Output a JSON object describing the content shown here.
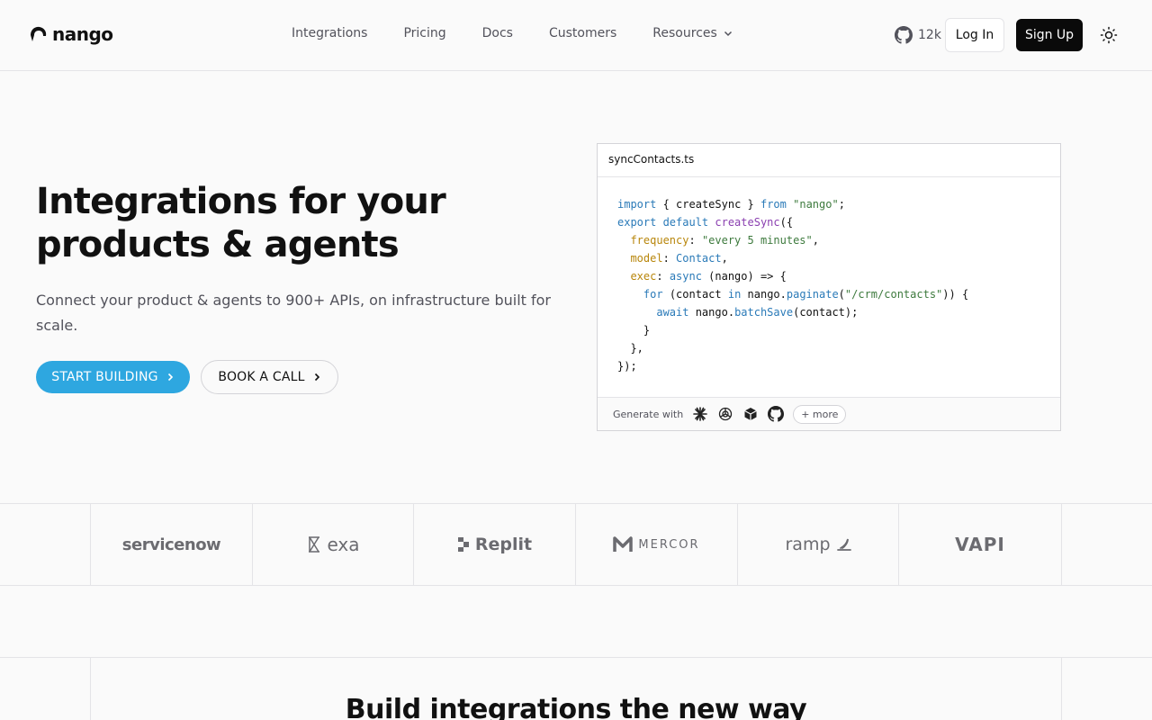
{
  "brand": {
    "name": "nango"
  },
  "nav": {
    "links": [
      {
        "label": "Integrations"
      },
      {
        "label": "Pricing"
      },
      {
        "label": "Docs"
      },
      {
        "label": "Customers"
      },
      {
        "label": "Resources"
      }
    ],
    "github_stars": "12k",
    "login_label": "Log In",
    "signup_label": "Sign Up"
  },
  "hero": {
    "title_line1": "Integrations for your",
    "title_line2": "products & agents",
    "subtitle": "Connect your product & agents to 900+ APIs, on infrastructure built for scale.",
    "cta_primary": "START BUILDING",
    "cta_secondary": "BOOK A CALL"
  },
  "code": {
    "filename": "syncContacts.ts",
    "tokens": {
      "import": "import",
      "brace_open": " { ",
      "createSync": "createSync",
      "brace_close": " } ",
      "from": "from",
      "nango_str": " \"nango\"",
      "semi": ";",
      "export_default": "export default",
      "createSync2": " createSync",
      "paren_open": "({",
      "frequency": "frequency",
      "freq_val": "\"every 5 minutes\"",
      "model": "model",
      "model_val": "Contact",
      "exec": "exec",
      "async": "async",
      "arrow": " (nango) => {",
      "for": "for",
      "for_mid1": " (contact ",
      "in": "in",
      "for_mid2": " nango.",
      "paginate": "paginate",
      "path_str": "\"/crm/contacts\"",
      "for_end": ")) {",
      "await": "await",
      "batch_obj": " nango.",
      "batchSave": "batchSave",
      "batch_end": "(contact);",
      "close1": "}",
      "close2": "},",
      "close3": "});"
    },
    "footer_label": "Generate with",
    "more_label": "+ more",
    "generator_icons": [
      "claude-icon",
      "openai-icon",
      "cube-icon",
      "github-icon"
    ]
  },
  "logos": [
    {
      "name": "servicenow"
    },
    {
      "name": "exa"
    },
    {
      "name": "Replit"
    },
    {
      "name": "MERCOR"
    },
    {
      "name": "ramp"
    },
    {
      "name": "VAPI"
    }
  ],
  "section2": {
    "title": "Build integrations the new way"
  },
  "colors": {
    "primary": "#2ea7e0",
    "dark": "#0a0a0a",
    "border": "#e4e4e7"
  }
}
